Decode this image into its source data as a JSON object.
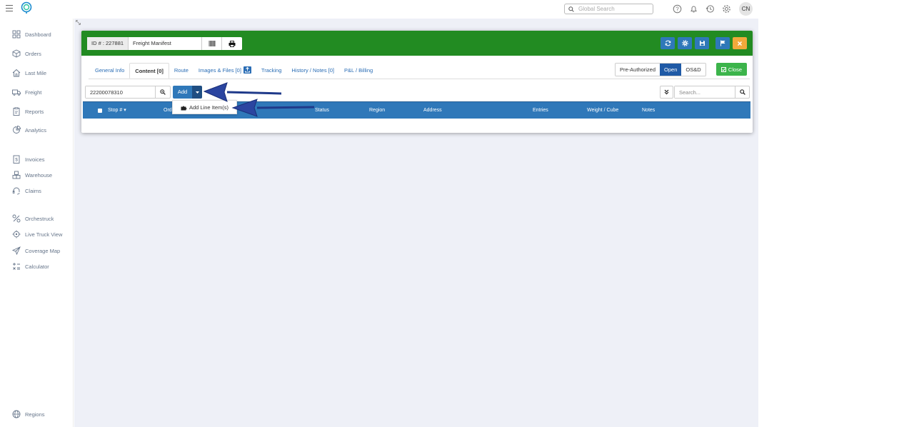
{
  "topbar": {
    "search_placeholder": "Global Search",
    "avatar_initials": "CN",
    "icons": [
      "menu-icon",
      "logo",
      "search-icon",
      "help-icon",
      "bell-icon",
      "history-icon",
      "gear-icon"
    ]
  },
  "sidebar": {
    "items": [
      {
        "label": "Dashboard",
        "icon": "dashboard-icon"
      },
      {
        "label": "Orders",
        "icon": "box-icon"
      },
      {
        "label": "Last Mile",
        "icon": "house-icon"
      },
      {
        "label": "Freight",
        "icon": "truck-icon"
      },
      {
        "label": "Reports",
        "icon": "report-icon"
      },
      {
        "label": "Analytics",
        "icon": "analytics-icon"
      },
      {
        "label": "Invoices",
        "icon": "invoice-icon"
      },
      {
        "label": "Warehouse",
        "icon": "warehouse-icon"
      },
      {
        "label": "Claims",
        "icon": "headset-icon"
      },
      {
        "label": "Orchestruck",
        "icon": "orchestruck-icon"
      },
      {
        "label": "Live Truck View",
        "icon": "target-icon"
      },
      {
        "label": "Coverage Map",
        "icon": "send-icon"
      },
      {
        "label": "Calculator",
        "icon": "calculator-icon"
      },
      {
        "label": "Regions",
        "icon": "globe-icon"
      }
    ]
  },
  "card": {
    "id_label": "ID # : 227881",
    "name": "Freight Manifest",
    "header_colors": {
      "bar": "#228b22",
      "blue_button": "#2f78b9",
      "orange_button": "#f0a93b"
    },
    "tabs": [
      {
        "label": "General Info",
        "active": false
      },
      {
        "label": "Content [0]",
        "active": true
      },
      {
        "label": "Route",
        "active": false
      },
      {
        "label": "Images & Files [0]",
        "active": false
      },
      {
        "label": "Tracking",
        "active": false
      },
      {
        "label": "History / Notes [0]",
        "active": false
      },
      {
        "label": "P&L / Billing",
        "active": false
      }
    ],
    "status": [
      {
        "label": "Pre-Authorized",
        "active": false
      },
      {
        "label": "Open",
        "active": true
      },
      {
        "label": "OS&D",
        "active": false
      }
    ],
    "close_label": "Close",
    "lookup_value": "22200078310",
    "add_label": "Add",
    "dropdown_item": "Add Line Item(s)",
    "search_placeholder": "Search...",
    "columns": [
      "Stop #",
      "Ord",
      "Status",
      "Region",
      "Address",
      "Entries",
      "Weight / Cube",
      "Notes"
    ]
  }
}
